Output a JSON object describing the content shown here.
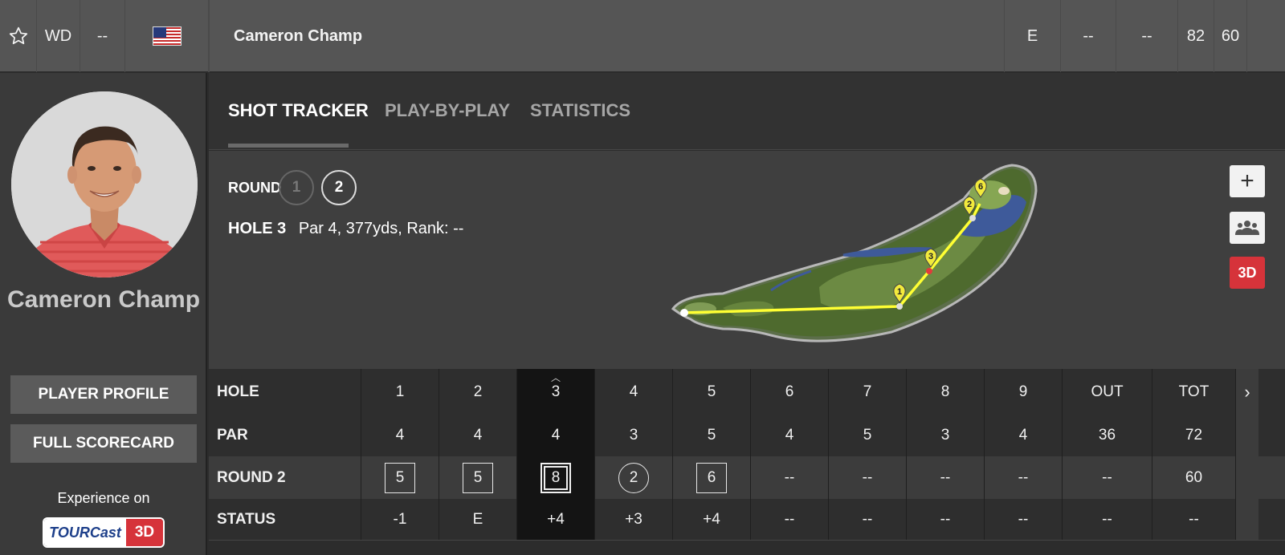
{
  "header": {
    "position": "WD",
    "movement": "--",
    "player_name": "Cameron Champ",
    "stats": [
      "E",
      "--",
      "--",
      "82",
      "60"
    ]
  },
  "sidebar": {
    "player_name": "Cameron Champ",
    "profile_button": "PLAYER PROFILE",
    "scorecard_button": "FULL SCORECARD",
    "experience_label": "Experience on",
    "tourcast_left": "TOURCast",
    "tourcast_right": "3D"
  },
  "tabs": [
    {
      "label": "SHOT TRACKER",
      "active": true
    },
    {
      "label": "PLAY-BY-PLAY",
      "active": false
    },
    {
      "label": "STATISTICS",
      "active": false
    }
  ],
  "shot_tracker": {
    "round_label": "ROUND",
    "rounds": [
      "1",
      "2"
    ],
    "active_round": "2",
    "hole_label": "HOLE 3",
    "hole_details": "Par 4, 377yds, Rank: --",
    "shot_markers": [
      "1",
      "2",
      "3",
      "6"
    ],
    "controls": {
      "zoom": "+",
      "three_d": "3D"
    }
  },
  "scorecard": {
    "columns": [
      "1",
      "2",
      "3",
      "4",
      "5",
      "6",
      "7",
      "8",
      "9",
      "OUT",
      "TOT"
    ],
    "current_hole": "3",
    "rows": [
      {
        "label": "HOLE",
        "values": [
          "1",
          "2",
          "3",
          "4",
          "5",
          "6",
          "7",
          "8",
          "9",
          "OUT",
          "TOT"
        ]
      },
      {
        "label": "PAR",
        "values": [
          "4",
          "4",
          "4",
          "3",
          "5",
          "4",
          "5",
          "3",
          "4",
          "36",
          "72"
        ]
      },
      {
        "label": "ROUND 2",
        "values": [
          "5",
          "5",
          "8",
          "2",
          "6",
          "--",
          "--",
          "--",
          "--",
          "--",
          "60"
        ]
      },
      {
        "label": "STATUS",
        "values": [
          "-1",
          "E",
          "+4",
          "+3",
          "+4",
          "--",
          "--",
          "--",
          "--",
          "--",
          "--"
        ]
      }
    ],
    "score_marks": [
      "bogey",
      "bogey",
      "double",
      "birdie",
      "bogey",
      "",
      "",
      "",
      "",
      "",
      ""
    ],
    "scroll_arrow": "›"
  },
  "colors": {
    "accent_red": "#d6333a",
    "shot_line": "#ffff33",
    "fairway": "#4f6b2f",
    "water": "#3e5a9a"
  }
}
